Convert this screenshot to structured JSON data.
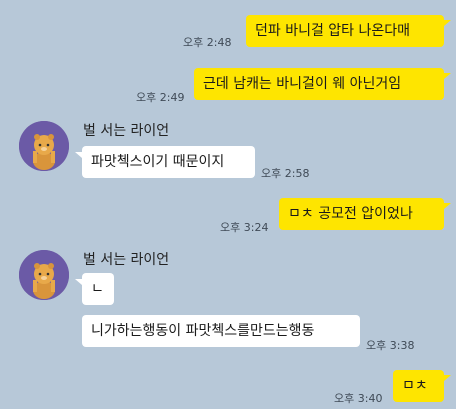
{
  "messages": [
    {
      "text": "던파 바니걸 압타 나온다매",
      "time": "오후 2:48"
    },
    {
      "text": "근데 남캐는 바니걸이 웨 아닌거임",
      "time": "오후 2:49"
    },
    {
      "sender": "벌 서는 라이언",
      "text": "파맛첵스이기 때문이지",
      "time": "오후 2:58"
    },
    {
      "text": "ㅁㅊ 공모전 압이었나",
      "time": "오후 3:24"
    },
    {
      "sender": "벌 서는 라이언",
      "text": "ㄴ"
    },
    {
      "text": "니가하는행동이 파맛첵스를만드는행동",
      "time": "오후 3:38"
    },
    {
      "text": "ㅁㅊ",
      "time": "오후 3:40"
    }
  ]
}
